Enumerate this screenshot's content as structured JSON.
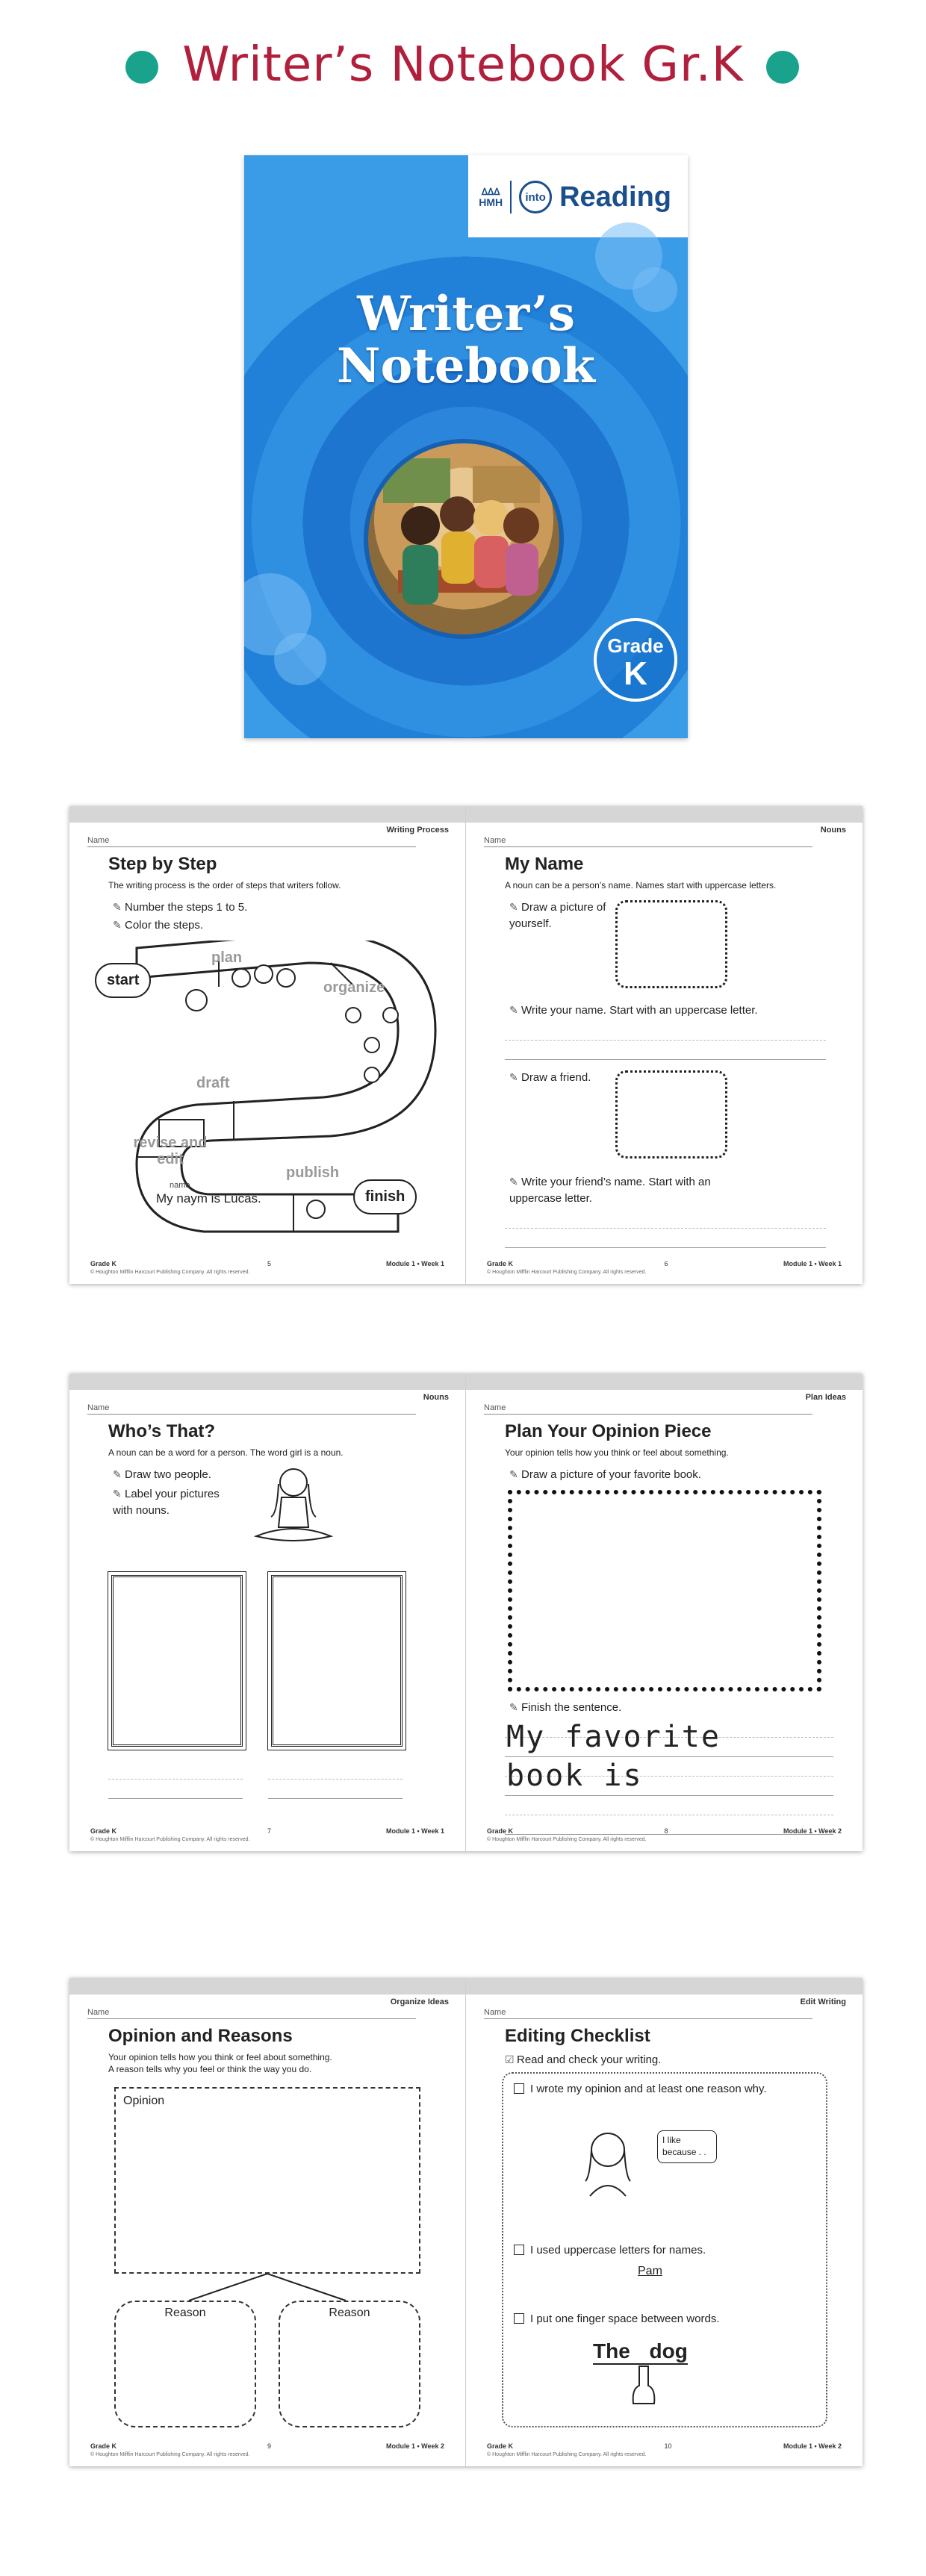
{
  "banner": {
    "title": "Writer’s Notebook Gr.K",
    "dot_color": "#1aa38c",
    "title_color": "#b0203c"
  },
  "cover": {
    "publisher": "HMH",
    "into_logo": "into",
    "series": "Reading",
    "title_line1": "Writer’s",
    "title_line2": "Notebook",
    "grade_word": "Grade",
    "grade_letter": "K"
  },
  "spread1": {
    "left": {
      "name_label": "Name",
      "tab": "Writing Process",
      "title": "Step by Step",
      "subtitle": "The writing process is the order of steps that writers follow.",
      "instructions": [
        "Number the steps 1 to 5.",
        "Color the steps."
      ],
      "steps": [
        "start",
        "plan",
        "organize",
        "draft",
        "revise and edit",
        "publish",
        "finish"
      ],
      "sample_label": "name",
      "sample_text": "My naym is Lucas.",
      "footer_grade": "Grade K",
      "footer_copyright": "© Houghton Mifflin Harcourt Publishing Company. All rights reserved.",
      "page_number": "5",
      "footer_module": "Module 1 • Week 1"
    },
    "right": {
      "name_label": "Name",
      "tab": "Nouns",
      "title": "My Name",
      "subtitle": "A noun can be a person’s name. Names start with uppercase letters.",
      "instr1": "Draw a picture of yourself.",
      "instr2": "Write your name. Start with an uppercase letter.",
      "instr3": "Draw a friend.",
      "instr4": "Write your friend’s name. Start with an uppercase letter.",
      "footer_grade": "Grade K",
      "footer_copyright": "© Houghton Mifflin Harcourt Publishing Company. All rights reserved.",
      "page_number": "6",
      "footer_module": "Module 1 • Week 1"
    }
  },
  "spread2": {
    "left": {
      "name_label": "Name",
      "tab": "Nouns",
      "title": "Who’s That?",
      "subtitle": "A noun can be a word for a person. The word girl is a noun.",
      "instr1": "Draw two people.",
      "instr2": "Label your pictures with nouns.",
      "footer_grade": "Grade K",
      "footer_copyright": "© Houghton Mifflin Harcourt Publishing Company. All rights reserved.",
      "page_number": "7",
      "footer_module": "Module 1 • Week 1"
    },
    "right": {
      "name_label": "Name",
      "tab": "Plan Ideas",
      "title": "Plan Your Opinion Piece",
      "subtitle": "Your opinion tells how you think or feel about something.",
      "instr1": "Draw a picture of your favorite book.",
      "instr2": "Finish the sentence.",
      "line1": "My favorite",
      "line2": "book is",
      "footer_grade": "Grade K",
      "footer_copyright": "© Houghton Mifflin Harcourt Publishing Company. All rights reserved.",
      "page_number": "8",
      "footer_module": "Module 1 • Week 2"
    }
  },
  "spread3": {
    "left": {
      "name_label": "Name",
      "tab": "Organize Ideas",
      "title": "Opinion and Reasons",
      "subtitle1": "Your opinion tells how you think or feel about something.",
      "subtitle2": "A reason tells why you feel or think the way you do.",
      "opinion_label": "Opinion",
      "reason_label": "Reason",
      "footer_grade": "Grade K",
      "footer_copyright": "© Houghton Mifflin Harcourt Publishing Company. All rights reserved.",
      "page_number": "9",
      "footer_module": "Module 1 • Week 2"
    },
    "right": {
      "name_label": "Name",
      "tab": "Edit Writing",
      "title": "Editing Checklist",
      "instr1": "Read and check your writing.",
      "item1": "I wrote my opinion and at least one reason why.",
      "speech": "I like because . .",
      "item2": "I used uppercase letters for names.",
      "example_name": "Pam",
      "item3": "I put one finger space between words.",
      "example_words": "The dog",
      "footer_grade": "Grade K",
      "footer_copyright": "© Houghton Mifflin Harcourt Publishing Company. All rights reserved.",
      "page_number": "10",
      "footer_module": "Module 1 • Week 2"
    }
  }
}
